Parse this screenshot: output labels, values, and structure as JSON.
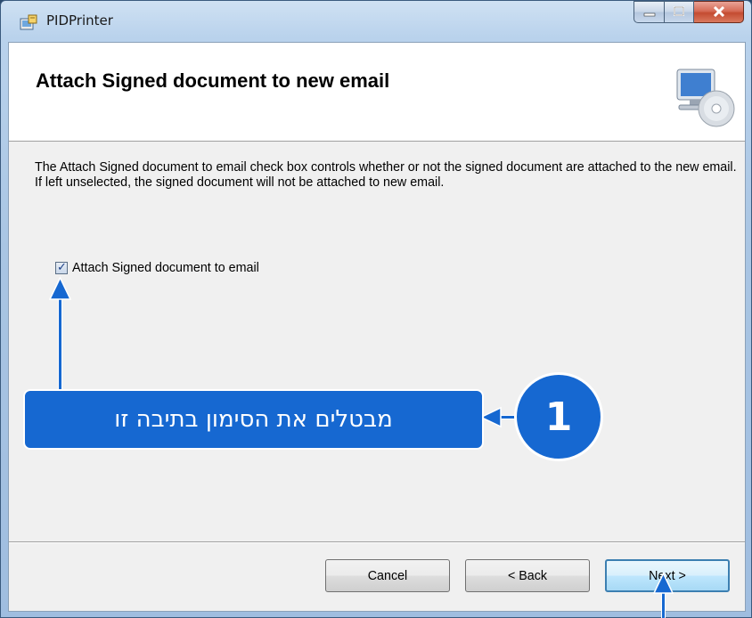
{
  "window": {
    "title": "PIDPrinter",
    "app_icon": "installer-icon"
  },
  "caption_buttons": {
    "minimize_icon": "minimize-icon",
    "maximize_icon": "maximize-icon",
    "close_icon": "close-icon"
  },
  "header": {
    "title": "Attach Signed document to new email",
    "icon": "computer-cd-icon"
  },
  "description": "The Attach Signed document to email check box controls whether or not the signed document are attached to the new email. If left unselected, the signed document will not be attached to new email.",
  "checkbox": {
    "label": "Attach Signed document to email",
    "checked": true
  },
  "annotation": {
    "step_number": "1",
    "callout_text": "מבטלים את הסימון בתיבה זו",
    "color": "#1668d1"
  },
  "buttons": {
    "cancel": "Cancel",
    "back": "< Back",
    "next": "Next >"
  }
}
